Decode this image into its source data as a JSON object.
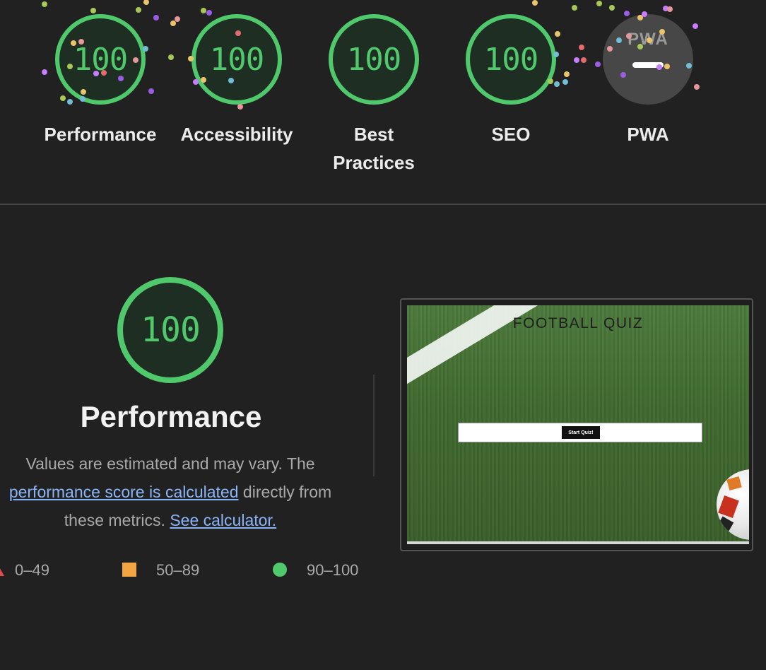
{
  "categories": [
    {
      "score": "100",
      "label": "Performance"
    },
    {
      "score": "100",
      "label": "Accessibility"
    },
    {
      "score": "100",
      "label": "Best Practices"
    },
    {
      "score": "100",
      "label": "SEO"
    },
    {
      "label": "PWA",
      "badge_text": "PWA"
    }
  ],
  "performance": {
    "score": "100",
    "title": "Performance",
    "desc_prefix": "Values are estimated and may vary. The ",
    "desc_link1": "performance score is calculated",
    "desc_middle": " directly from these metrics. ",
    "desc_link2": "See calculator."
  },
  "legend": {
    "fail": "0–49",
    "average": "50–89",
    "pass": "90–100"
  },
  "screenshot": {
    "page_title": "FOOTBALL QUIZ",
    "button_label": "Start Quiz!"
  },
  "colors": {
    "pass": "#4fc96b",
    "average": "#f2a542",
    "fail": "#e24c4b",
    "background": "#212121",
    "link": "#8ab4f8"
  }
}
